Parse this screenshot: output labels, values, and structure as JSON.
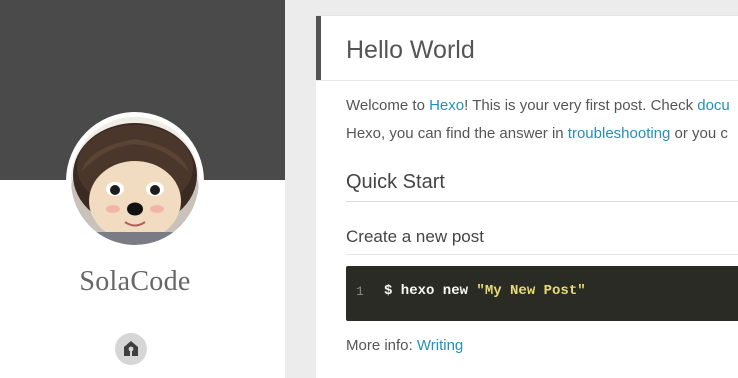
{
  "sidebar": {
    "site_title": "SolaCode",
    "home_icon": "home-icon",
    "colors": {
      "banner": "#4a4a4a",
      "title": "#666666"
    }
  },
  "article": {
    "title": "Hello World",
    "intro": {
      "part1": "Welcome to ",
      "hexo_link": "Hexo",
      "part2": "! This is your very first post. Check ",
      "docs_link": "docu"
    },
    "intro2": {
      "part1": "Hexo, you can find the answer in ",
      "troubleshooting_link": "troubleshooting",
      "part2": " or you c"
    },
    "quick_start_heading": "Quick Start",
    "create_post_heading": "Create a new post",
    "code": {
      "line_number": "1",
      "command": "$ hexo new ",
      "argument": "\"My New Post\""
    },
    "more_info": {
      "label": "More info: ",
      "link": "Writing"
    },
    "colors": {
      "link": "#258fb8",
      "code_bg": "#2b2b26",
      "code_string": "#e6db74"
    }
  }
}
